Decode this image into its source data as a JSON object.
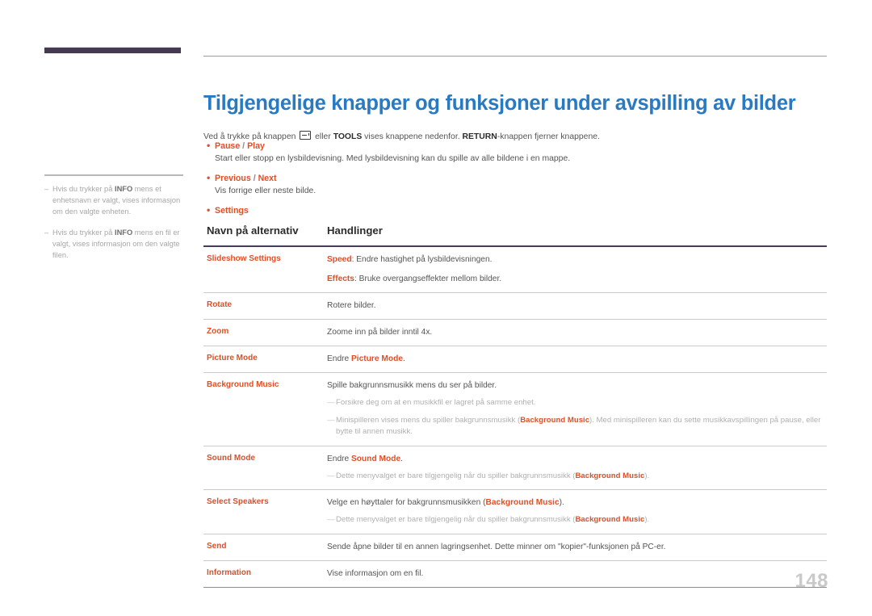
{
  "sidebar": {
    "notes": [
      {
        "dash": "–",
        "pre": "Hvis du trykker på ",
        "bold": "INFO",
        "post": " mens et enhetsnavn er valgt, vises informasjon om den valgte enheten."
      },
      {
        "dash": "–",
        "pre": "Hvis du trykker på ",
        "bold": "INFO",
        "post": " mens en fil er valgt, vises informasjon om den valgte filen."
      }
    ]
  },
  "main": {
    "title": "Tilgjengelige knapper og funksjoner under avspilling av bilder",
    "intro": {
      "part1": "Ved å trykke på knappen ",
      "icon": "return-key-icon",
      "part2": " eller ",
      "bold1": "TOOLS",
      "part3": " vises knappene nedenfor. ",
      "bold2": "RETURN",
      "part4": "-knappen fjerner knappene."
    },
    "bullets": [
      {
        "dot": "•",
        "label_a": "Pause",
        "sep": " / ",
        "label_b": "Play",
        "desc": "Start eller stopp en lysbildevisning. Med lysbildevisning kan du spille av alle bildene i en mappe."
      },
      {
        "dot": "•",
        "label_a": "Previous",
        "sep": " / ",
        "label_b": "Next",
        "desc": "Vis forrige eller neste bilde."
      },
      {
        "dot": "•",
        "label_a": "Settings",
        "sep": "",
        "label_b": "",
        "desc": ""
      }
    ],
    "table": {
      "headers": [
        "Navn på alternativ",
        "Handlinger"
      ],
      "rows": [
        {
          "name": "Slideshow Settings",
          "lines": [
            {
              "key": "Speed",
              "text": ": Endre hastighet på lysbildevisningen."
            },
            {
              "key": "Effects",
              "text": ": Bruke overgangseffekter mellom bilder.",
              "gap": true
            }
          ],
          "subnotes": []
        },
        {
          "name": "Rotate",
          "lines": [
            {
              "key": "",
              "text": "Rotere bilder."
            }
          ],
          "subnotes": []
        },
        {
          "name": "Zoom",
          "lines": [
            {
              "key": "",
              "text": "Zoome inn på bilder inntil 4x."
            }
          ],
          "subnotes": []
        },
        {
          "name": "Picture Mode",
          "lines": [
            {
              "key": "",
              "text": "Endre ",
              "key_after": "Picture Mode",
              "text_after": "."
            }
          ],
          "subnotes": []
        },
        {
          "name": "Background Music",
          "lines": [
            {
              "key": "",
              "text": "Spille bakgrunnsmusikk mens du ser på bilder."
            }
          ],
          "subnotes": [
            {
              "dash": "––",
              "pre": "Forsikre deg om at en musikkfil er lagret på samme enhet.",
              "key": "",
              "post": ""
            },
            {
              "dash": "––",
              "pre": "Minispilleren vises mens du spiller bakgrunnsmusikk (",
              "key": "Background Music",
              "post": "). Med minispilleren kan du sette musikkavspillingen på pause, eller bytte til annen musikk."
            }
          ]
        },
        {
          "name": "Sound Mode",
          "lines": [
            {
              "key": "",
              "text": "Endre ",
              "key_after": "Sound Mode",
              "text_after": "."
            }
          ],
          "subnotes": [
            {
              "dash": "––",
              "pre": "Dette menyvalget er bare tilgjengelig når du spiller bakgrunnsmusikk (",
              "key": "Background Music",
              "post": ")."
            }
          ]
        },
        {
          "name": "Select Speakers",
          "lines": [
            {
              "key": "",
              "text": "Velge en høyttaler for bakgrunnsmusikken (",
              "key_after": "Background Music",
              "text_after": ")."
            }
          ],
          "subnotes": [
            {
              "dash": "––",
              "pre": "Dette menyvalget er bare tilgjengelig når du spiller bakgrunnsmusikk (",
              "key": "Background Music",
              "post": ")."
            }
          ]
        },
        {
          "name": "Send",
          "lines": [
            {
              "key": "",
              "text": "Sende åpne bilder til en annen lagringsenhet. Dette minner om \"kopier\"-funksjonen på PC-er."
            }
          ],
          "subnotes": []
        },
        {
          "name": "Information",
          "lines": [
            {
              "key": "",
              "text": "Vise informasjon om en fil."
            }
          ],
          "subnotes": []
        }
      ]
    }
  },
  "footer": {
    "page_number": "148"
  },
  "colors": {
    "title_blue": "#2a7ac2",
    "accent_orange": "#e04e26",
    "marker_purple": "#443b52",
    "body_gray": "#545454",
    "note_gray": "#a7a7a7"
  }
}
